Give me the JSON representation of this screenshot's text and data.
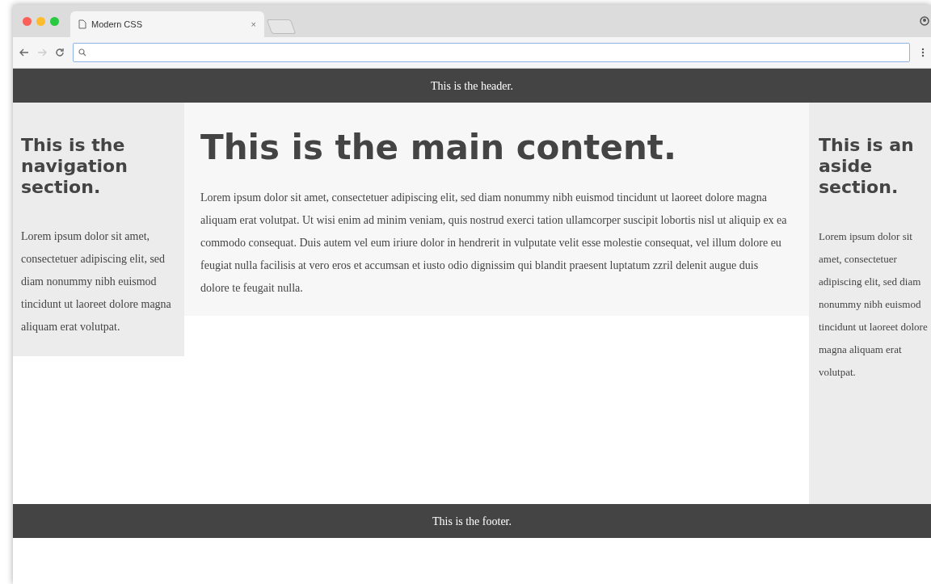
{
  "browser": {
    "tab": {
      "title": "Modern CSS",
      "close": "×"
    }
  },
  "page": {
    "header": "This is the header.",
    "nav": {
      "heading": "This is the navigation section.",
      "text": "Lorem ipsum dolor sit amet, consectetuer adipiscing elit, sed diam nonummy nibh euismod tincidunt ut laoreet dolore magna aliquam erat volutpat."
    },
    "main": {
      "heading": "This is the main content.",
      "text": "Lorem ipsum dolor sit amet, consectetuer adipiscing elit, sed diam nonummy nibh euismod tincidunt ut laoreet dolore magna aliquam erat volutpat. Ut wisi enim ad minim veniam, quis nostrud exerci tation ullamcorper suscipit lobortis nisl ut aliquip ex ea commodo consequat. Duis autem vel eum iriure dolor in hendrerit in vulputate velit esse molestie consequat, vel illum dolore eu feugiat nulla facilisis at vero eros et accumsan et iusto odio dignissim qui blandit praesent luptatum zzril delenit augue duis dolore te feugait nulla."
    },
    "aside": {
      "heading": "This is an aside section.",
      "text": "Lorem ipsum dolor sit amet, consectetuer adipiscing elit, sed diam nonummy nibh euismod tincidunt ut laoreet dolore magna aliquam erat volutpat."
    },
    "footer": "This is the footer."
  }
}
